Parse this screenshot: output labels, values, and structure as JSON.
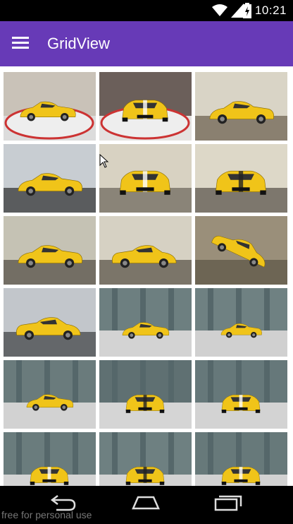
{
  "status_bar": {
    "time": "10:21"
  },
  "app_bar": {
    "title": "GridView",
    "menu_icon": "hamburger-menu-icon"
  },
  "grid": {
    "columns": 3,
    "items": [
      {
        "view": "turntable-front-left",
        "bg": "#c9c2b8",
        "floor": "#dcdcdc"
      },
      {
        "view": "turntable-front",
        "bg": "#6b5f5a",
        "floor": "#e4e2e0"
      },
      {
        "view": "side-left",
        "bg": "#d9d4c6",
        "floor": "#8a8070"
      },
      {
        "view": "side-left-low",
        "bg": "#c8cdd2",
        "floor": "#5a5c5e"
      },
      {
        "view": "front",
        "bg": "#d8d2c2",
        "floor": "#8a8478"
      },
      {
        "view": "rear",
        "bg": "#ddd8c8",
        "floor": "#7d776d"
      },
      {
        "view": "side-left",
        "bg": "#c5c2b4",
        "floor": "#736e64"
      },
      {
        "view": "rear-left",
        "bg": "#d6d1c3",
        "floor": "#7b7569"
      },
      {
        "view": "top-angle",
        "bg": "#9a8f7a",
        "floor": "#6d6554"
      },
      {
        "view": "rear-left-low",
        "bg": "#c2c6cb",
        "floor": "#64676a"
      },
      {
        "view": "studio-side",
        "bg": "#6d7f80",
        "floor": "#d3d3d3"
      },
      {
        "view": "studio-side-small",
        "bg": "#6f8182",
        "floor": "#d0d0d0"
      },
      {
        "view": "studio-side-left",
        "bg": "#6a7b7c",
        "floor": "#d2d2d2"
      },
      {
        "view": "studio-rear",
        "bg": "#5f7072",
        "floor": "#d5d5d5"
      },
      {
        "view": "studio-front",
        "bg": "#66787a",
        "floor": "#d3d3d3"
      },
      {
        "view": "studio-front-left",
        "bg": "#6a7c7d",
        "floor": "#d4d4d4"
      },
      {
        "view": "studio-rear-left",
        "bg": "#6e8081",
        "floor": "#d3d3d3"
      },
      {
        "view": "studio-front-right",
        "bg": "#67797a",
        "floor": "#d2d2d2"
      }
    ]
  },
  "nav_bar": {
    "back_icon": "back-icon",
    "home_icon": "home-icon",
    "recents_icon": "recents-icon"
  },
  "watermark": "free for personal use",
  "colors": {
    "primary": "#673ab7",
    "car": "#f0c419"
  }
}
